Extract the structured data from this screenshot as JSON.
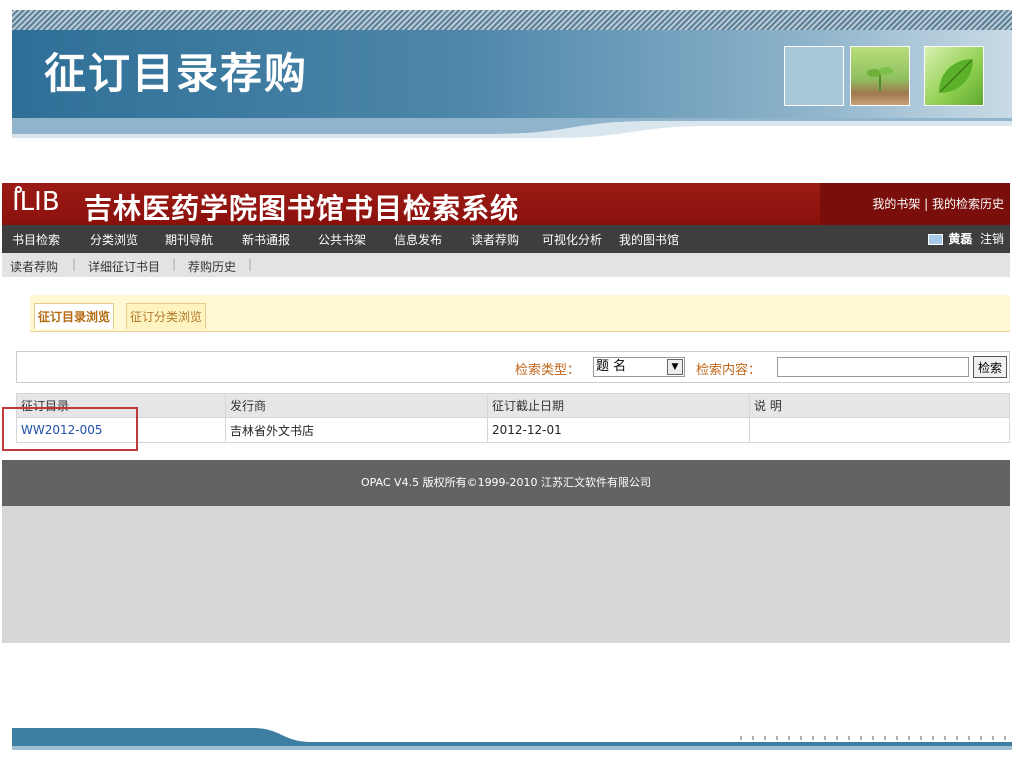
{
  "slide": {
    "title": "征订目录荐购"
  },
  "app": {
    "logo": "ILIB",
    "title": "吉林医药学院图书馆书目检索系统",
    "header_links": "我的书架 | 我的检索历史",
    "nav_items": [
      "书目检索",
      "分类浏览",
      "期刊导航",
      "新书通报",
      "公共书架",
      "信息发布",
      "读者荐购",
      "可视化分析",
      "我的图书馆"
    ],
    "user_name": "黄磊",
    "logout": "注销",
    "subnav_items": [
      "读者荐购",
      "详细征订书目",
      "荐购历史"
    ],
    "tabs": [
      "征订目录浏览",
      "征订分类浏览"
    ],
    "search": {
      "type_label": "检索类型：",
      "type_value": "题 名",
      "content_label": "检索内容：",
      "content_value": "",
      "button_label": "检索"
    },
    "table": {
      "headers": [
        "征订目录",
        "发行商",
        "征订截止日期",
        "说 明"
      ],
      "rows": [
        [
          "WW2012-005",
          "吉林省外文书店",
          "2012-12-01",
          ""
        ]
      ]
    },
    "footer": "OPAC V4.5    版权所有©1999-2010 江苏汇文软件有限公司"
  },
  "colors": {
    "banner_blue": "#2f6f97",
    "header_red": "#9c1b16",
    "nav_dark": "#3e3e3e",
    "accent_orange": "#c0661a",
    "link_blue": "#1f4fa8",
    "highlight_red": "#c0393b"
  }
}
